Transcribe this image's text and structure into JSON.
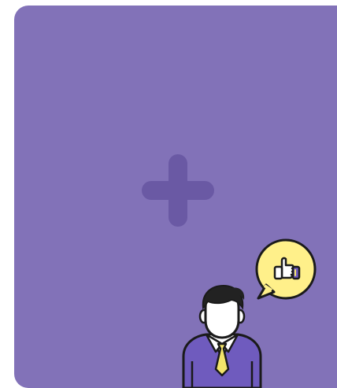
{
  "card": {
    "background": "#8272B8",
    "accent": "#6A59A4"
  },
  "icons": {
    "add": "plus-icon",
    "reaction": "thumbs-up-icon"
  },
  "colors": {
    "bubble": "#FFF08A",
    "outline": "#1a1a1a",
    "suit": "#6F5BBE",
    "tie": "#F3E46A",
    "hair": "#222222"
  }
}
